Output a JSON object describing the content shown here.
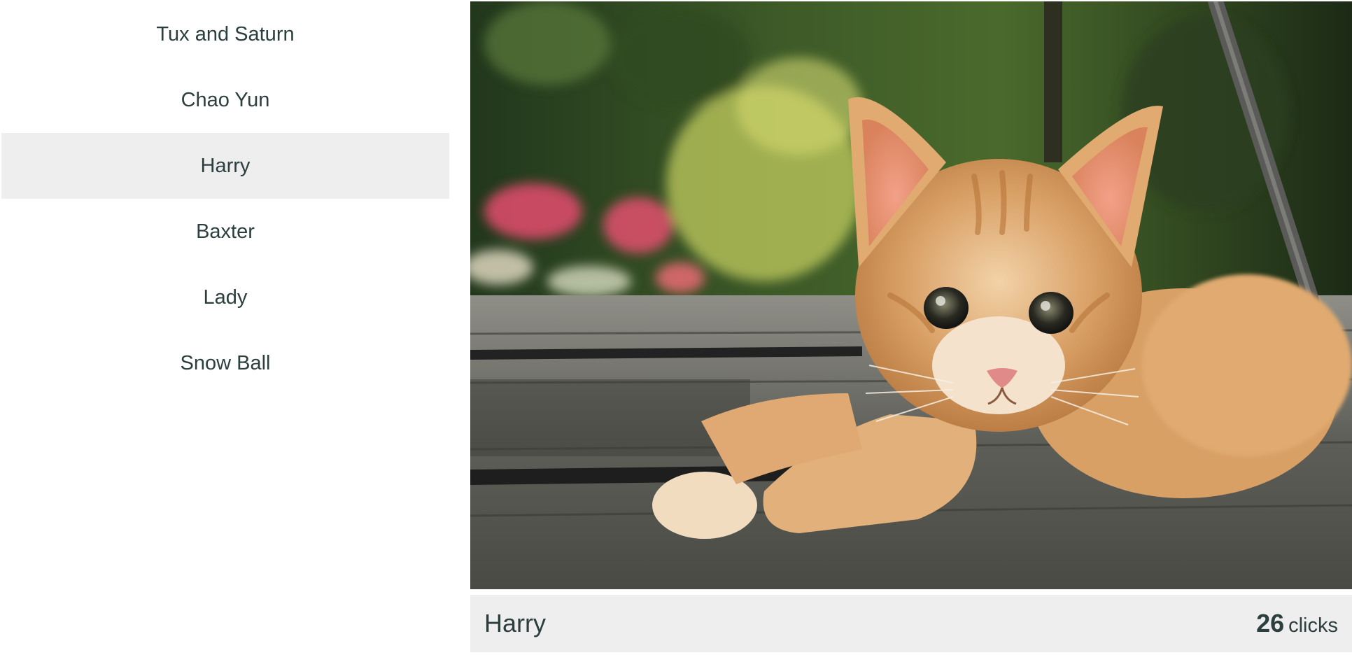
{
  "cats": [
    {
      "name": "Tux and Saturn"
    },
    {
      "name": "Chao Yun"
    },
    {
      "name": "Harry"
    },
    {
      "name": "Baxter"
    },
    {
      "name": "Lady"
    },
    {
      "name": "Snow Ball"
    }
  ],
  "selected": {
    "name": "Harry",
    "clicks": "26",
    "clicks_unit": "clicks",
    "image_subject": "orange-tabby-kitten"
  },
  "colors": {
    "text": "#2c3e3e",
    "highlight": "#eeeeee",
    "background": "#ffffff"
  }
}
